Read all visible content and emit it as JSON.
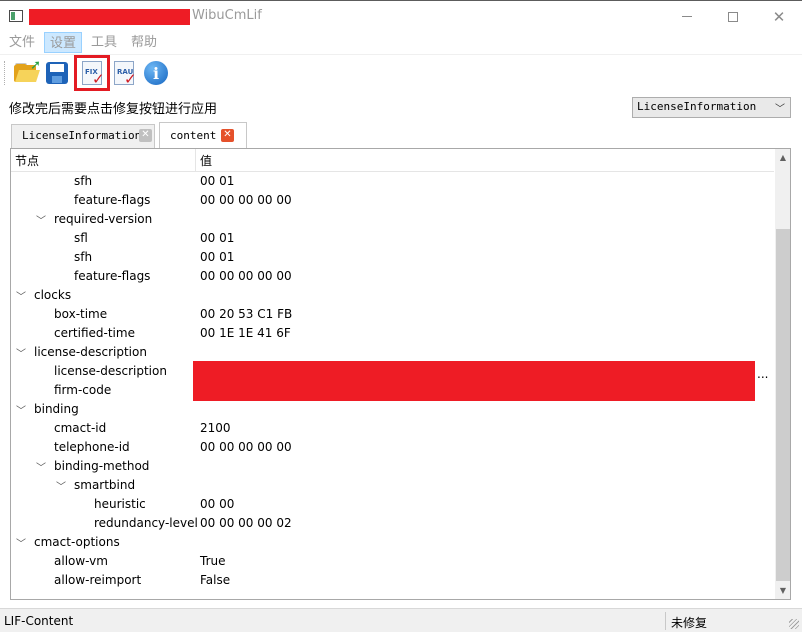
{
  "window": {
    "title": "WibuCmLif",
    "icons": {
      "app": "app-icon",
      "minimize": "minimize-icon",
      "maximize": "maximize-icon",
      "close": "close-icon"
    }
  },
  "menu": [
    "文件",
    "设置",
    "工具",
    "帮助"
  ],
  "toolbar": {
    "buttons": [
      {
        "id": "open",
        "icon": "open-folder-icon"
      },
      {
        "id": "save",
        "icon": "save-disk-icon"
      },
      {
        "id": "fix",
        "icon": "fix-document-icon",
        "text": "FIX",
        "highlighted": true
      },
      {
        "id": "rau",
        "icon": "rau-document-icon",
        "text": "RAU"
      },
      {
        "id": "info",
        "icon": "info-icon",
        "text": "i"
      }
    ]
  },
  "hint": "修改完后需要点击修复按钮进行应用",
  "view_select": {
    "value": "LicenseInformation"
  },
  "tabs": [
    {
      "label": "LicenseInformation",
      "active": false
    },
    {
      "label": "content",
      "active": true
    }
  ],
  "tree": {
    "headers": {
      "node": "节点",
      "value": "值"
    },
    "rows": [
      {
        "name": "sfh",
        "value": "00 01"
      },
      {
        "name": "feature-flags",
        "value": "00 00 00 00 00"
      },
      {
        "name": "required-version",
        "value": ""
      },
      {
        "name": "sfl",
        "value": "00 01"
      },
      {
        "name": "sfh",
        "value": "00 01"
      },
      {
        "name": "feature-flags",
        "value": "00 00 00 00 00"
      },
      {
        "name": "clocks",
        "value": ""
      },
      {
        "name": "box-time",
        "value": "00 20 53 C1 FB"
      },
      {
        "name": "certified-time",
        "value": "00 1E 1E 41 6F"
      },
      {
        "name": "license-description",
        "value": ""
      },
      {
        "name": "license-description",
        "value": ""
      },
      {
        "name": "firm-code",
        "value": ""
      },
      {
        "name": "binding",
        "value": ""
      },
      {
        "name": "cmact-id",
        "value": "2100"
      },
      {
        "name": "telephone-id",
        "value": "00 00 00 00 00"
      },
      {
        "name": "binding-method",
        "value": ""
      },
      {
        "name": "smartbind",
        "value": ""
      },
      {
        "name": "heuristic",
        "value": "00 00"
      },
      {
        "name": "redundancy-level",
        "value": "00 00 00 00 02"
      },
      {
        "name": "cmact-options",
        "value": ""
      },
      {
        "name": "allow-vm",
        "value": "True"
      },
      {
        "name": "allow-reimport",
        "value": "False"
      }
    ],
    "truncation": "..."
  },
  "status": {
    "left": "LIF-Content",
    "right": "未修复"
  },
  "colors": {
    "redaction": "#ee1c25",
    "highlight_border": "#e31b23",
    "menu_active_bg": "#cce8ff"
  }
}
